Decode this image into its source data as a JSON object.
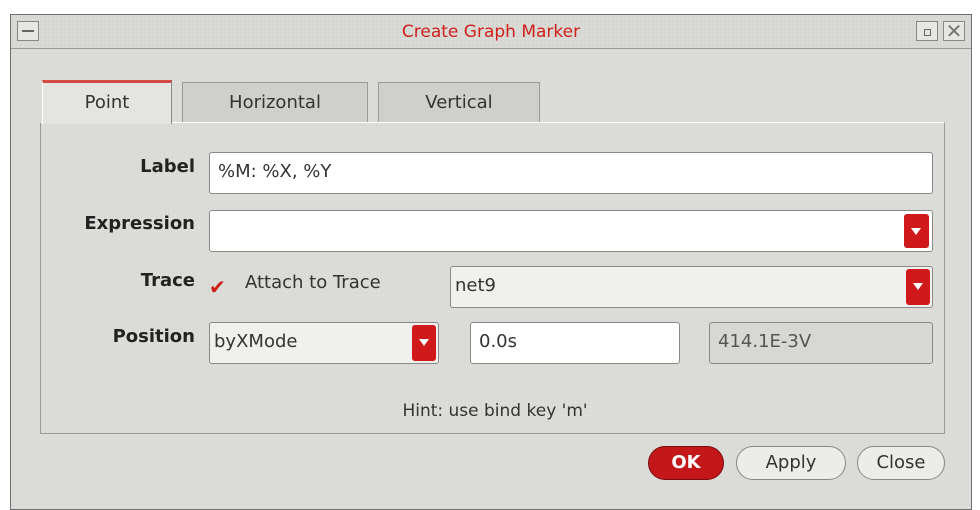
{
  "window": {
    "title": "Create Graph Marker"
  },
  "tabs": [
    {
      "label": "Point",
      "active": true
    },
    {
      "label": "Horizontal",
      "active": false
    },
    {
      "label": "Vertical",
      "active": false
    }
  ],
  "form": {
    "label": {
      "caption": "Label",
      "value": "%M: %X, %Y"
    },
    "expression": {
      "caption": "Expression",
      "value": ""
    },
    "trace": {
      "caption": "Trace",
      "checkbox_label": "Attach to Trace",
      "checked": true,
      "selected": "net9"
    },
    "position": {
      "caption": "Position",
      "mode": "byXMode",
      "x_value": "0.0s",
      "y_value": "414.1E-3V"
    }
  },
  "hint": "Hint: use bind key 'm'",
  "buttons": {
    "ok": "OK",
    "apply": "Apply",
    "close": "Close"
  },
  "colors": {
    "accent": "#d0201c",
    "ok_button": "#c3171a"
  }
}
